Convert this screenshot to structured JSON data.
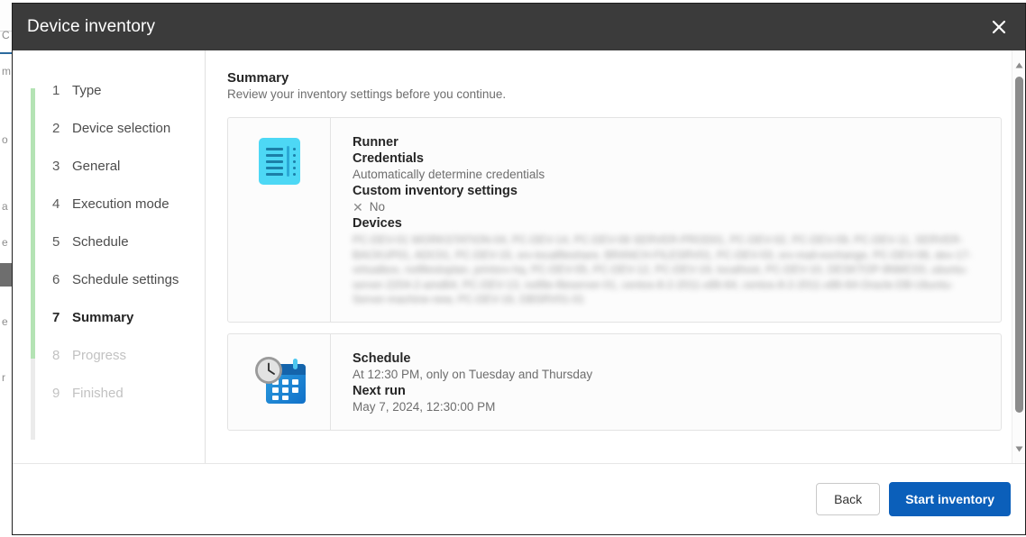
{
  "background_window": {
    "edge_texts": [
      "C",
      "m",
      "o",
      "a",
      "e",
      "e",
      "r"
    ]
  },
  "dialog": {
    "title": "Device inventory",
    "close_icon": "close-icon"
  },
  "wizard": {
    "steps": [
      {
        "number": "1",
        "label": "Type",
        "state": "done"
      },
      {
        "number": "2",
        "label": "Device selection",
        "state": "done"
      },
      {
        "number": "3",
        "label": "General",
        "state": "done"
      },
      {
        "number": "4",
        "label": "Execution mode",
        "state": "done"
      },
      {
        "number": "5",
        "label": "Schedule",
        "state": "done"
      },
      {
        "number": "6",
        "label": "Schedule settings",
        "state": "done"
      },
      {
        "number": "7",
        "label": "Summary",
        "state": "current"
      },
      {
        "number": "8",
        "label": "Progress",
        "state": "disabled"
      },
      {
        "number": "9",
        "label": "Finished",
        "state": "disabled"
      }
    ],
    "rail_color": "#ebebeb",
    "rail_fill_color": "#b4e3b4"
  },
  "main": {
    "heading": "Summary",
    "subheading": "Review your inventory settings before you continue.",
    "cards": [
      {
        "icon": "runner-document-icon",
        "fields": [
          {
            "kind": "label",
            "text": "Runner"
          },
          {
            "kind": "label",
            "text": "Credentials"
          },
          {
            "kind": "value",
            "text": "Automatically determine credentials"
          },
          {
            "kind": "label",
            "text": "Custom inventory settings"
          },
          {
            "kind": "bool",
            "text": "No",
            "mark": "✕"
          },
          {
            "kind": "label",
            "text": "Devices"
          },
          {
            "kind": "blurred",
            "text": "PC-DEV-01 WORKSTATION-04, PC-DEV-14, PC-DEV-08 SERVER-PROD01, PC-DEV-02, PC-DEV-09, PC-DEV-11, SERVER-BACKUP01, ADC01, PC-DEV-15, srv-localfileshare, BRANCH-FILESRV01, PC-DEV-03, srv-mail-exchange, PC-DEV-06, dev-17-virtualbox, nxtfilestoplan, printsrv-hq, PC-DEV-05, PC-DEV-12, PC-DEV-19, localhost, PC-DEV-10, DESKTOP-9NMC03, ubuntu-server-2204-2-amd64, PC-DEV-13, nxtfile-fileserver-01, centos-8-2-2011-x86-64, centos-8-2-2011-x86-64-Oracle-DB-Ubuntu-Server-machine-new, PC-DEV-16, DBSRV01-01"
          }
        ]
      },
      {
        "icon": "calendar-clock-icon",
        "fields": [
          {
            "kind": "label",
            "text": "Schedule"
          },
          {
            "kind": "value",
            "text": "At 12:30 PM, only on Tuesday and Thursday"
          },
          {
            "kind": "label",
            "text": "Next run"
          },
          {
            "kind": "value",
            "text": "May 7, 2024, 12:30:00 PM"
          }
        ]
      }
    ]
  },
  "footer": {
    "back_label": "Back",
    "start_label": "Start inventory",
    "primary_color": "#0b5fba"
  },
  "scrollbar": {
    "up_icon": "scroll-up-arrow-icon",
    "down_icon": "scroll-down-arrow-icon"
  }
}
